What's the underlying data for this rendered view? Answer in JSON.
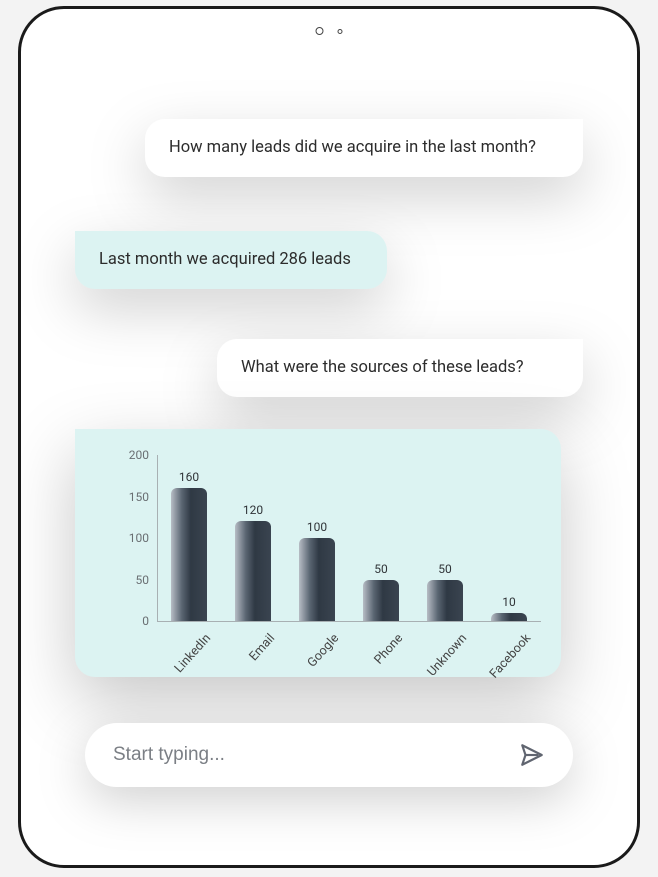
{
  "messages": {
    "user1": "How many leads did we acquire in the last month?",
    "bot1": "Last month we acquired 286 leads",
    "user2": "What were the sources of these leads?"
  },
  "input": {
    "placeholder": "Start typing..."
  },
  "chart_data": {
    "type": "bar",
    "categories": [
      "LinkedIn",
      "Email",
      "Google",
      "Phone",
      "Unknown",
      "Facebook"
    ],
    "values": [
      160,
      120,
      100,
      50,
      50,
      10
    ],
    "title": "",
    "xlabel": "",
    "ylabel": "",
    "ylim": [
      0,
      200
    ],
    "yticks": [
      0,
      50,
      100,
      150,
      200
    ]
  }
}
